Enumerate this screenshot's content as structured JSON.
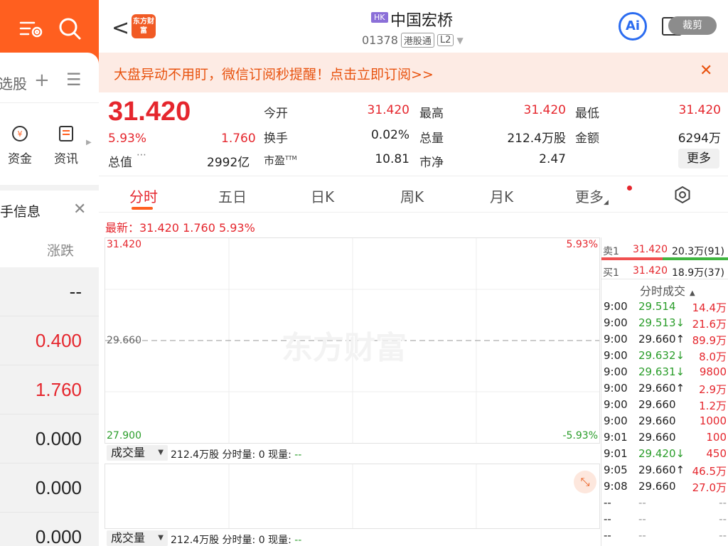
{
  "left": {
    "tab_label": "选股",
    "shortcuts": [
      {
        "label": "资金"
      },
      {
        "label": "资讯"
      }
    ],
    "info_title": "手信息",
    "info_sub": "涨跌",
    "rows": [
      "--",
      "0.400",
      "1.760",
      "0.000",
      "0.000",
      "0.000"
    ]
  },
  "header": {
    "back_glyph": "<",
    "logo_text": "东方财富",
    "market_badge": "HK",
    "stock_name": "中国宏桥",
    "code": "01378",
    "tag1": "港股通",
    "tag2": "L2",
    "ai_label": "Ai",
    "crop_label": "裁剪"
  },
  "banner": {
    "text": "大盘异动不用盯，微信订阅秒提醒！点击立即订阅>>",
    "close": "✕"
  },
  "quote": {
    "price": "31.420",
    "change_pct": "5.93%",
    "change_amt": "1.760",
    "mcap_label": "总值",
    "mcap_value": "2992亿",
    "open_label": "今开",
    "open": "31.420",
    "high_label": "最高",
    "high": "31.420",
    "low_label": "最低",
    "low": "31.420",
    "turnover_label": "换手",
    "turnover": "0.02%",
    "volume_label": "总量",
    "volume": "212.4万股",
    "amount_label": "金额",
    "amount": "6294万",
    "pe_label": "市盈",
    "pe_sup": "TTM",
    "pe": "10.81",
    "pb_label": "市净",
    "pb": "2.47",
    "more_label": "更多"
  },
  "tabs": [
    "分时",
    "五日",
    "日K",
    "周K",
    "月K",
    "更多"
  ],
  "latest_line": "最新：31.420  1.760  5.93%",
  "chart": {
    "y_top": "31.420",
    "y_mid": "29.660",
    "y_bottom": "27.900",
    "pct_top": "5.93%",
    "pct_bottom": "-5.93%",
    "watermark": "东方财富"
  },
  "volume_bar": {
    "select_label": "成交量",
    "total": "212.4万股",
    "text": "分时量: 0  现量: ",
    "dash": "--"
  },
  "book": {
    "sell_label": "卖1",
    "sell_price": "31.420",
    "sell_vol": "20.3万(91)",
    "buy_label": "买1",
    "buy_price": "31.420",
    "buy_vol": "18.9万(37)"
  },
  "trades_title": "分时成交",
  "trades": [
    {
      "time": "9:00",
      "price": "29.514",
      "pc": "green",
      "vol": "14.4万",
      "vc": "red"
    },
    {
      "time": "9:00",
      "price": "29.513↓",
      "pc": "green",
      "vol": "21.6万",
      "vc": "red"
    },
    {
      "time": "9:00",
      "price": "29.660↑",
      "pc": "black",
      "vol": "89.9万",
      "vc": "red"
    },
    {
      "time": "9:00",
      "price": "29.632↓",
      "pc": "green",
      "vol": "8.0万",
      "vc": "red"
    },
    {
      "time": "9:00",
      "price": "29.631↓",
      "pc": "green",
      "vol": "9800",
      "vc": "red"
    },
    {
      "time": "9:00",
      "price": "29.660↑",
      "pc": "black",
      "vol": "2.9万",
      "vc": "red"
    },
    {
      "time": "9:00",
      "price": "29.660",
      "pc": "black",
      "vol": "1.2万",
      "vc": "red"
    },
    {
      "time": "9:00",
      "price": "29.660",
      "pc": "black",
      "vol": "1000",
      "vc": "red"
    },
    {
      "time": "9:01",
      "price": "29.660",
      "pc": "black",
      "vol": "100",
      "vc": "red"
    },
    {
      "time": "9:01",
      "price": "29.420↓",
      "pc": "green",
      "vol": "450",
      "vc": "red"
    },
    {
      "time": "9:05",
      "price": "29.660↑",
      "pc": "black",
      "vol": "46.5万",
      "vc": "red"
    },
    {
      "time": "9:08",
      "price": "29.660",
      "pc": "black",
      "vol": "27.0万",
      "vc": "red"
    },
    {
      "time": "--",
      "price": "--",
      "pc": "grey",
      "vol": "--",
      "vc": "grey"
    },
    {
      "time": "--",
      "price": "--",
      "pc": "grey",
      "vol": "--",
      "vc": "grey"
    },
    {
      "time": "--",
      "price": "--",
      "pc": "grey",
      "vol": "--",
      "vc": "grey"
    }
  ],
  "colors": {
    "brand": "#ff5f1f",
    "up": "#e5262d",
    "down": "#2a9d2a",
    "accent_ai": "#2b6cf0"
  }
}
